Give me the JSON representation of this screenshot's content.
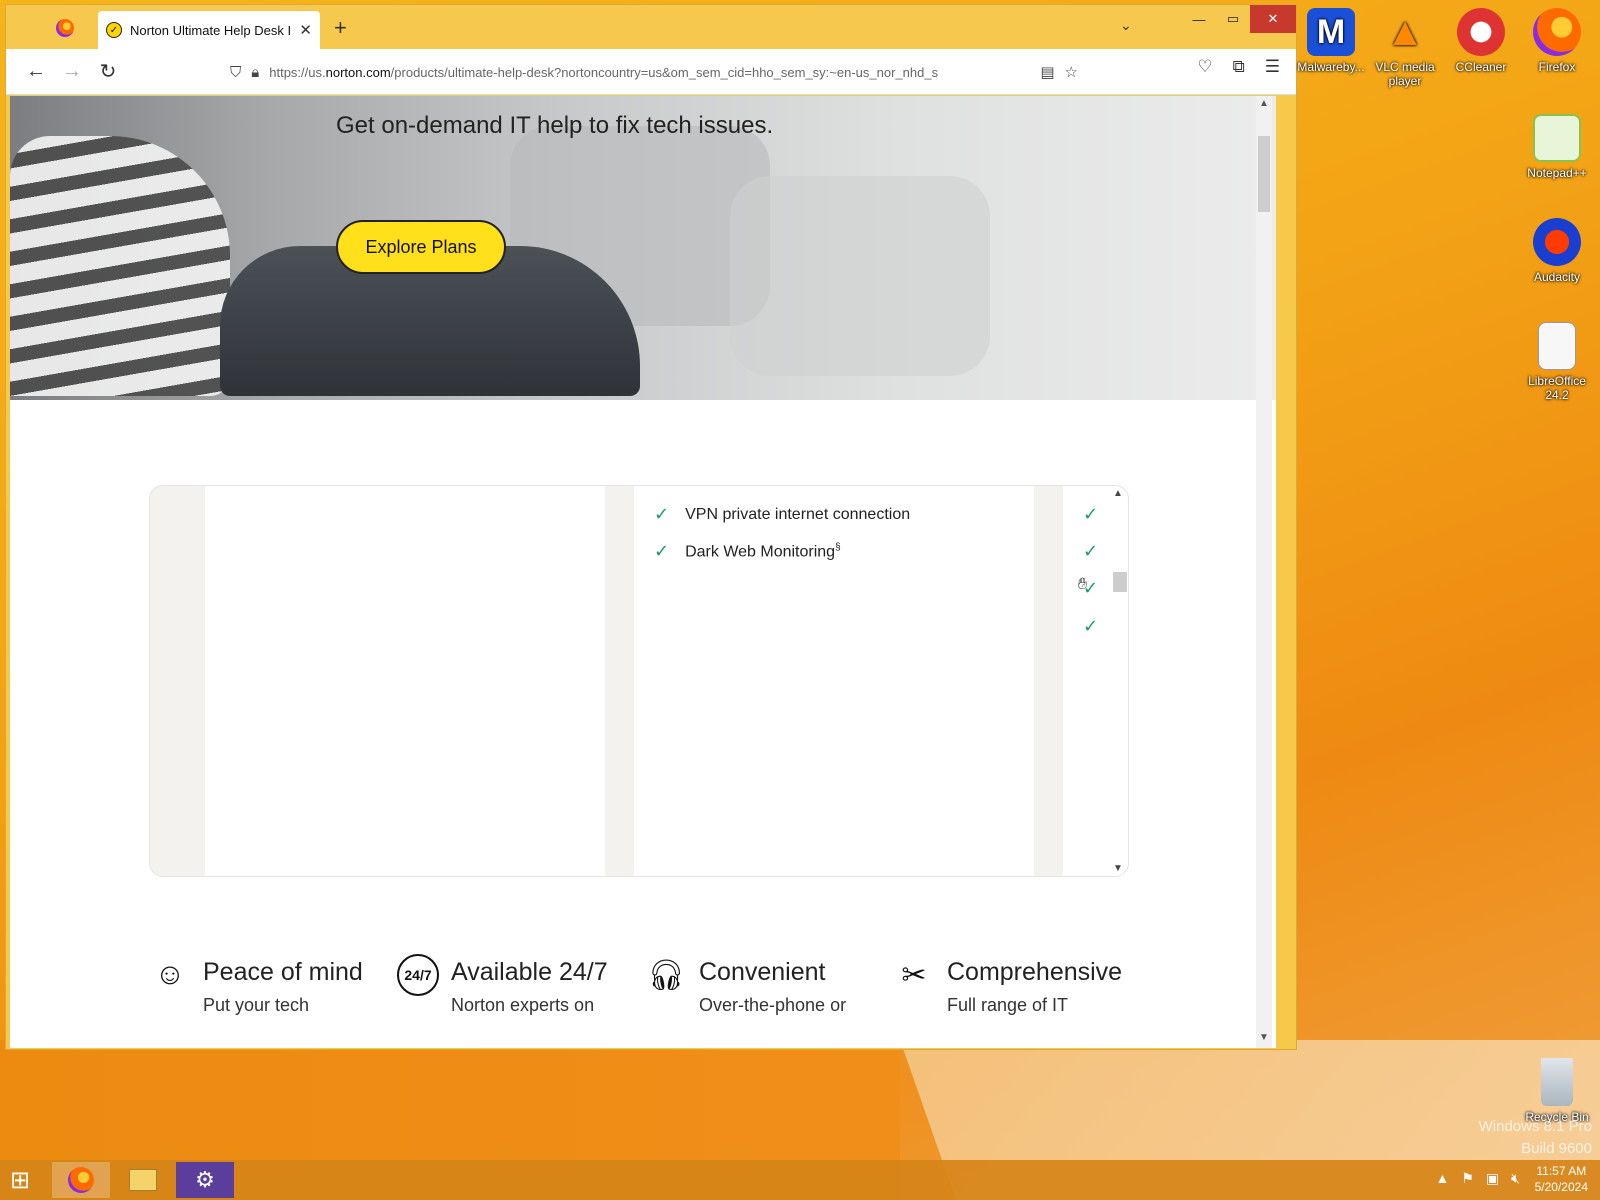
{
  "browser": {
    "tab_title": "Norton Ultimate Help Desk I Or",
    "url_prefix": "https://us.",
    "url_domain": "norton.com",
    "url_rest": "/products/ultimate-help-desk?nortoncountry=us&om_sem_cid=hho_sem_sy:~en-us_nor_nhd_s"
  },
  "hero": {
    "subtitle": "Get on-demand IT help to fix tech issues.",
    "cta": "Explore Plans"
  },
  "comparison": {
    "features": [
      {
        "label": "VPN private internet connection",
        "sup": ""
      },
      {
        "label": "Dark Web Monitoring",
        "sup": "§"
      }
    ]
  },
  "benefits": [
    {
      "title": "Peace of mind",
      "desc": "Put your tech",
      "icon": "smiley-icon"
    },
    {
      "title": "Available 24/7",
      "desc": "Norton experts on",
      "icon": "clock-247-icon"
    },
    {
      "title": "Convenient",
      "desc": "Over-the-phone or",
      "icon": "headset-icon"
    },
    {
      "title": "Comprehensive",
      "desc": "Full range of IT",
      "icon": "tools-icon"
    }
  ],
  "desktop_icons": [
    {
      "label": "Malwareby...",
      "color": "#1a4fd8"
    },
    {
      "label": "VLC media player",
      "color": "#ff8800"
    },
    {
      "label": "CCleaner",
      "color": "#d33"
    },
    {
      "label": "Firefox",
      "color": "#ff6a00"
    },
    {
      "label": "Notepad++",
      "color": "#8bc34a"
    },
    {
      "label": "Audacity",
      "color": "#1a3fd0"
    },
    {
      "label": "LibreOffice 24.2",
      "color": "#f2f2f2"
    },
    {
      "label": "Recycle Bin",
      "color": "#cfd8dc"
    }
  ],
  "system": {
    "watermark_line1": "Windows 8.1 Pro",
    "watermark_line2": "Build 9600",
    "time": "11:57 AM",
    "date": "5/20/2024"
  },
  "colors": {
    "accent": "#ffe01b",
    "check": "#1d9b6c"
  }
}
